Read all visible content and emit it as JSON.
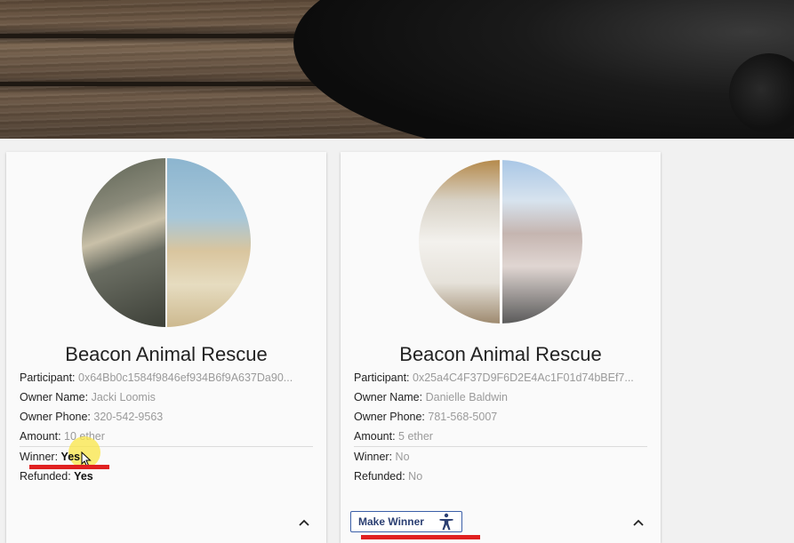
{
  "cards": [
    {
      "org": "Beacon Animal Rescue",
      "participant_label": "Participant: ",
      "participant": "0x64Bb0c1584f9846ef934B6f9A637Da90...",
      "owner_name_label": "Owner Name: ",
      "owner_name": "Jacki Loomis",
      "owner_phone_label": "Owner Phone: ",
      "owner_phone": "320-542-9563",
      "amount_label": "Amount: ",
      "amount": "10 ether",
      "winner_label": "Winner: ",
      "winner": "Yes",
      "refunded_label": "Refunded: ",
      "refunded": "Yes",
      "expand_icon": "^"
    },
    {
      "org": "Beacon Animal Rescue",
      "participant_label": "Participant: ",
      "participant": "0x25a4C4F37D9F6D2E4Ac1F01d74bBEf7...",
      "owner_name_label": "Owner Name: ",
      "owner_name": "Danielle Baldwin",
      "owner_phone_label": "Owner Phone: ",
      "owner_phone": "781-568-5007",
      "amount_label": "Amount: ",
      "amount": "5 ether",
      "winner_label": "Winner: ",
      "winner": "No",
      "refunded_label": "Refunded: ",
      "refunded": "No",
      "button_label": "Make Winner",
      "button_icon": "accessibility-icon",
      "expand_icon": "^"
    }
  ],
  "colors": {
    "annotation_red": "#e02020",
    "button_border": "#3b5fa8",
    "value_gray": "#9a9a9a"
  }
}
